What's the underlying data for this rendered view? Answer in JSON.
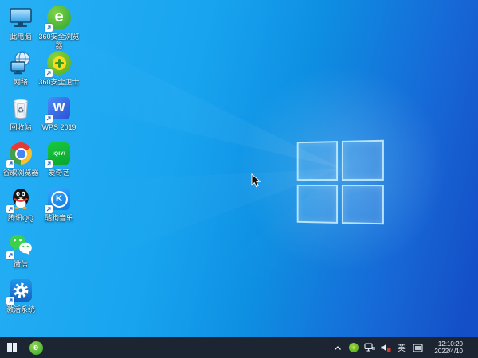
{
  "wallpaper": {
    "light": "#27b0f5",
    "mid": "#0e8fe2",
    "deep": "#144fc7"
  },
  "desktop": {
    "icons": [
      {
        "id": "this-pc",
        "label": "此电脑"
      },
      {
        "id": "360-browser",
        "label": "360安全浏览器"
      },
      {
        "id": "network",
        "label": "网络"
      },
      {
        "id": "360-safeguard",
        "label": "360安全卫士"
      },
      {
        "id": "recycle-bin",
        "label": "回收站"
      },
      {
        "id": "wps-2019",
        "label": "WPS 2019"
      },
      {
        "id": "chrome",
        "label": "谷歌浏览器"
      },
      {
        "id": "iqiyi",
        "label": "爱奇艺"
      },
      {
        "id": "qq",
        "label": "腾讯QQ"
      },
      {
        "id": "kugou",
        "label": "酷狗音乐"
      },
      {
        "id": "wechat",
        "label": "微信"
      },
      {
        "id": "activate",
        "label": "激活系统"
      }
    ]
  },
  "logos": {
    "browser360_letter": "e",
    "wps_letter": "W",
    "iqiyi_text": "iQIYI",
    "kugou_letter": "K",
    "guard_plus": "+"
  },
  "taskbar": {
    "colors": {
      "bar": "#1d2532"
    },
    "tray": {
      "ime_label": "英",
      "clock_time": "12:10:20",
      "clock_date": "2022/4/10"
    }
  }
}
